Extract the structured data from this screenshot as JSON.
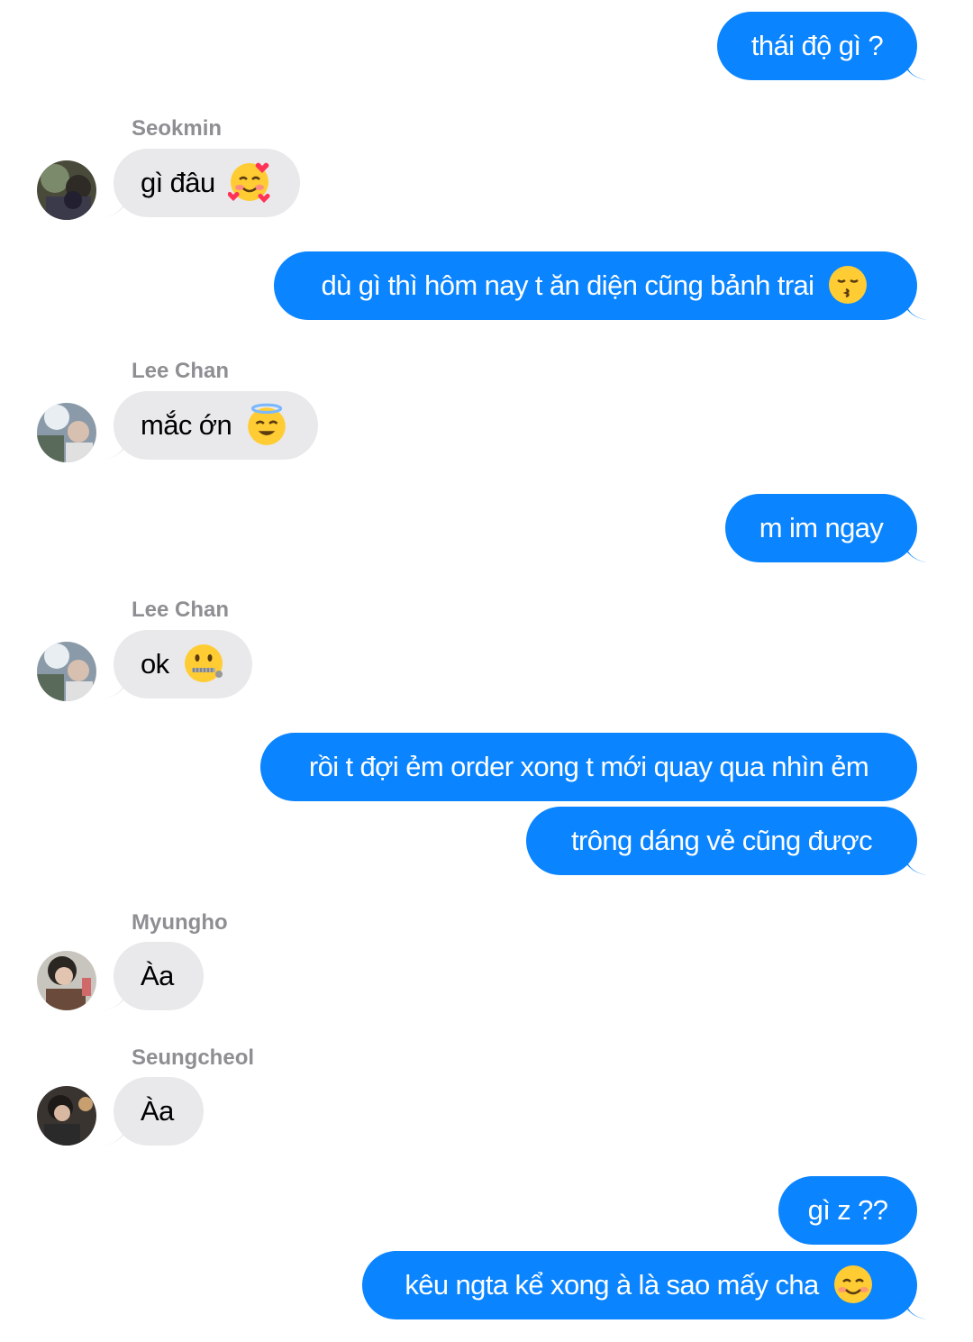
{
  "colors": {
    "sent_bubble": "#0a84ff",
    "received_bubble": "#e9e9eb",
    "sender_name": "#8e8e93"
  },
  "messages": [
    {
      "text": "thái độ gì ?"
    },
    {
      "sender": "Seokmin",
      "text": "gì đâu",
      "emoji": "smiling-face-with-hearts-emoji"
    },
    {
      "text": "dù gì thì hôm nay t ăn diện cũng bảnh trai",
      "emoji": "kissing-face-emoji"
    },
    {
      "sender": "Lee Chan",
      "text": "mắc ớn",
      "emoji": "smiling-face-with-halo-emoji"
    },
    {
      "text": "m im ngay"
    },
    {
      "sender": "Lee Chan",
      "text": "ok",
      "emoji": "zipper-mouth-face-emoji"
    },
    {
      "text": "rồi t đợi ẻm order xong t mới quay qua nhìn ẻm"
    },
    {
      "text": "trông dáng vẻ cũng được"
    },
    {
      "sender": "Myungho",
      "text": "Àa"
    },
    {
      "sender": "Seungcheol",
      "text": "Àa"
    },
    {
      "text": "gì z ??"
    },
    {
      "text": "kêu ngta kể xong à là sao mấy cha",
      "emoji": "smiling-face-emoji"
    }
  ]
}
